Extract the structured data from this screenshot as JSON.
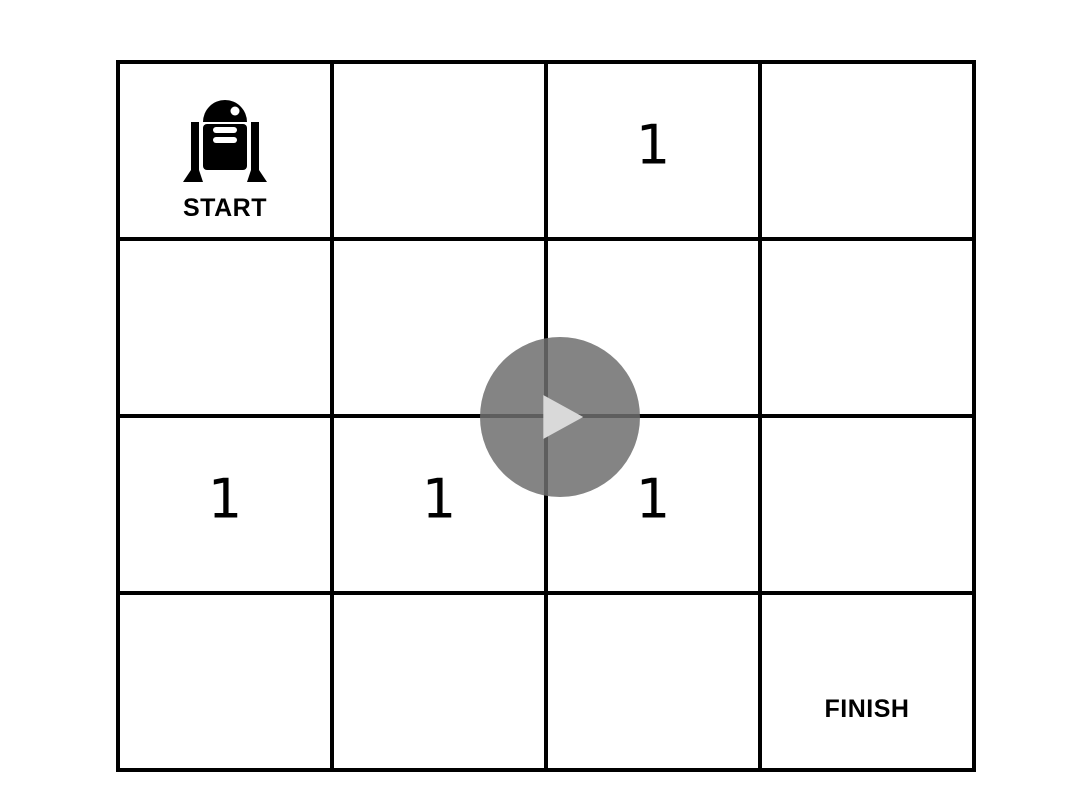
{
  "board": {
    "rows": 4,
    "columns": 4,
    "cells": [
      [
        "",
        "",
        "1",
        ""
      ],
      [
        "",
        "",
        "",
        ""
      ],
      [
        "1",
        "1",
        "1",
        ""
      ],
      [
        "",
        "",
        "",
        ""
      ]
    ],
    "start": {
      "label": "START",
      "icon": "robot-icon",
      "row": 0,
      "col": 0
    },
    "finish": {
      "label": "FINISH",
      "row": 3,
      "col": 3
    }
  },
  "overlay": {
    "icon": "play-icon",
    "color": "#6e6e6e"
  }
}
